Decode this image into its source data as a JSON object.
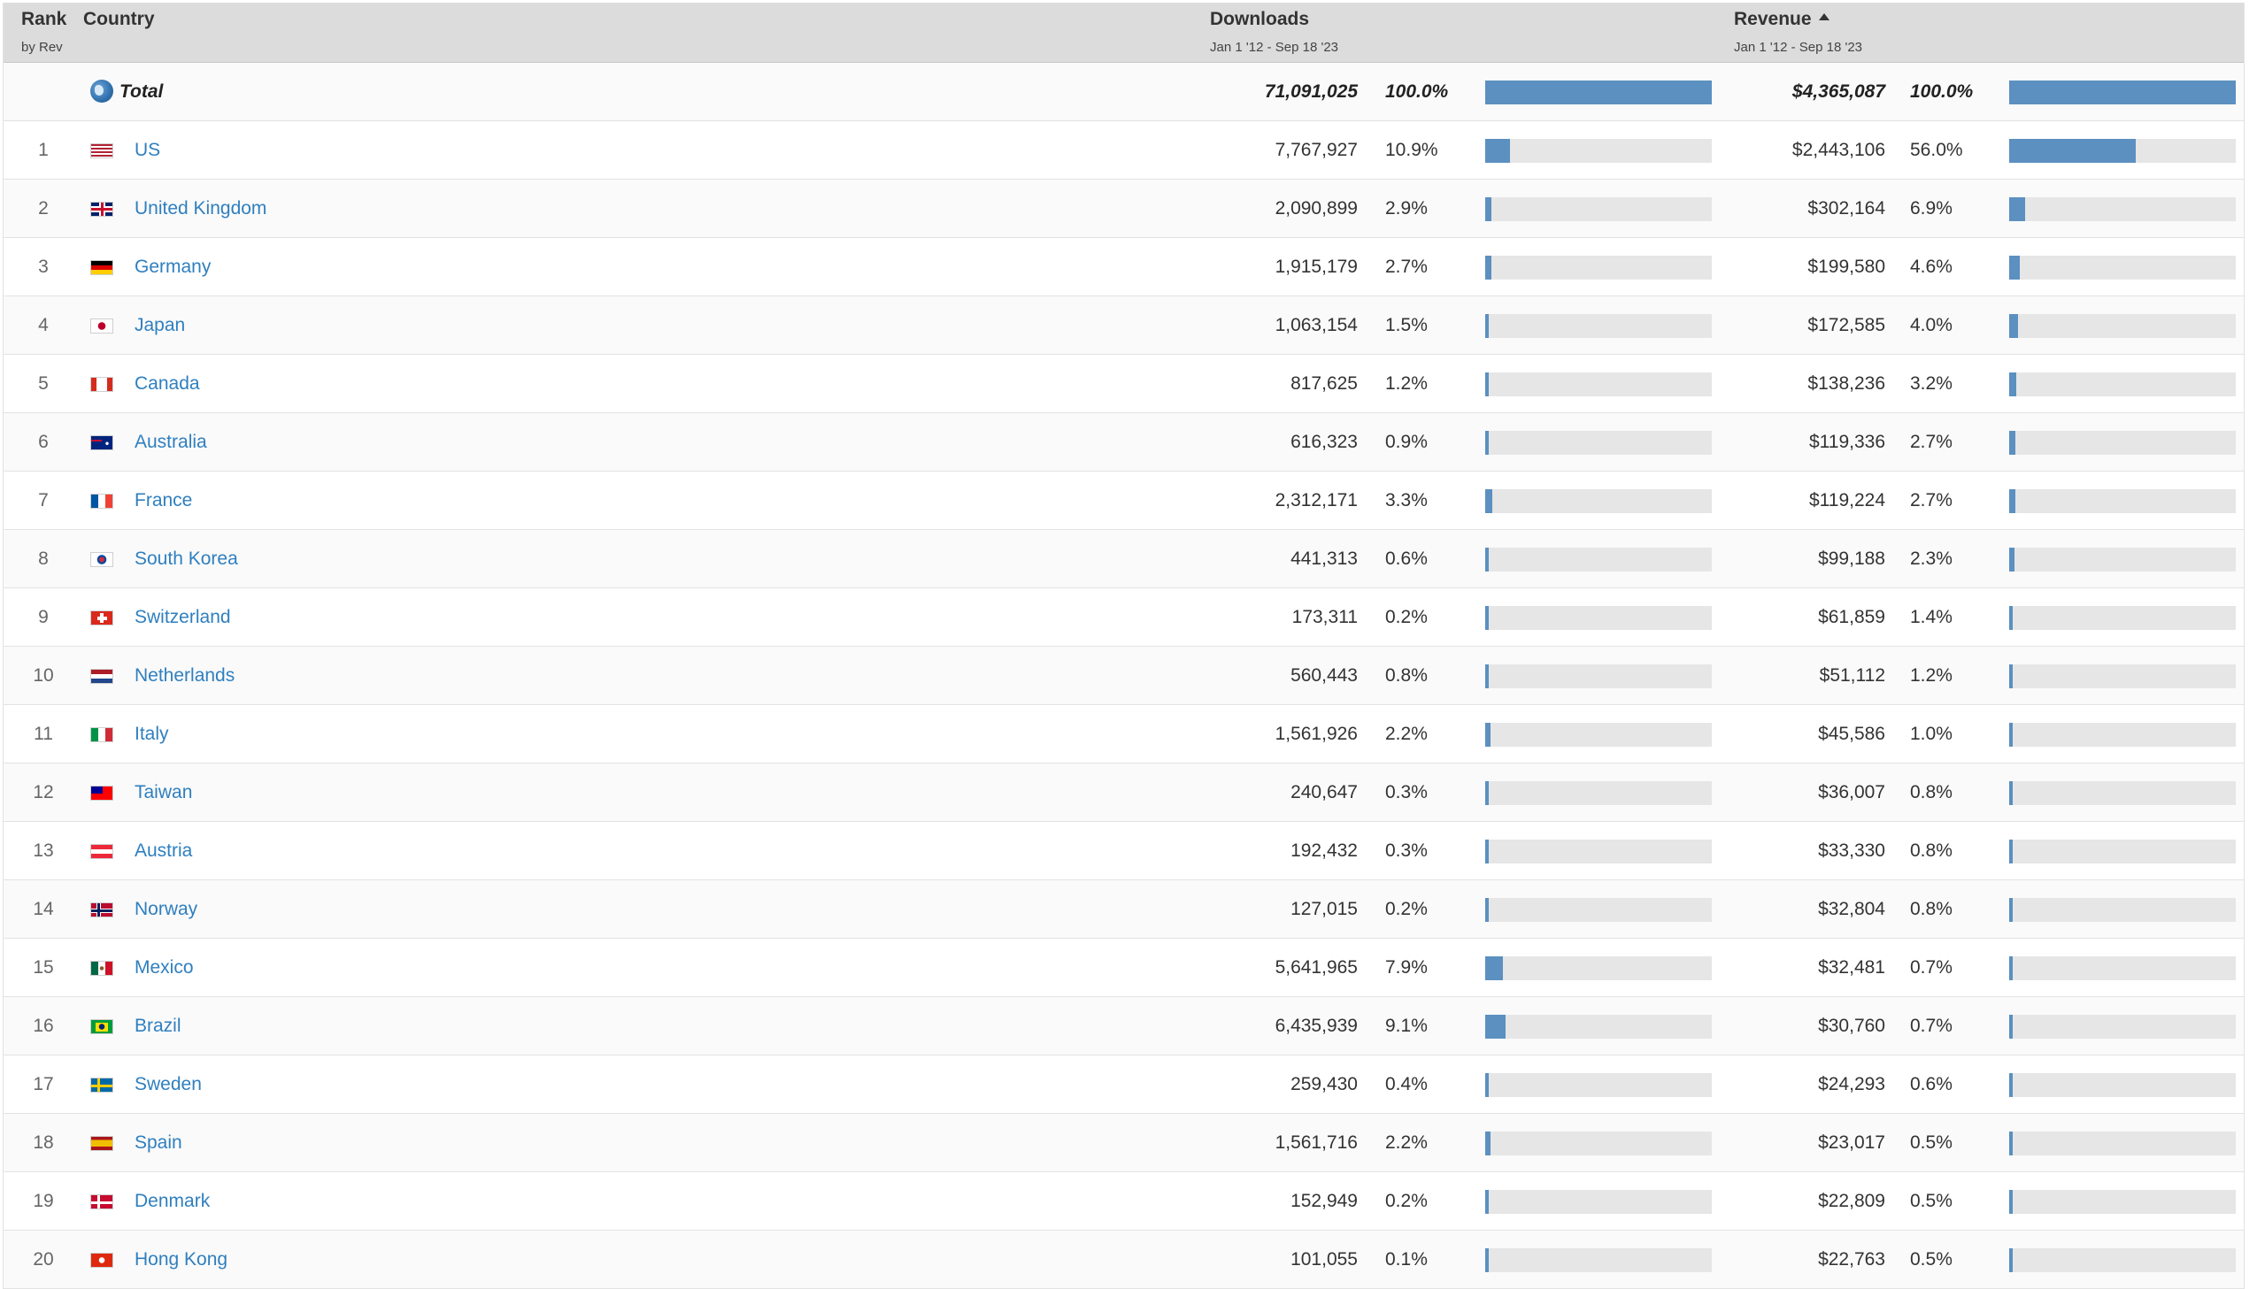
{
  "header": {
    "rank_label": "Rank",
    "rank_sub": "by Rev",
    "country_label": "Country",
    "downloads_label": "Downloads",
    "downloads_range": "Jan 1 '12 - Sep 18 '23",
    "revenue_label": "Revenue",
    "revenue_range": "Jan 1 '12 - Sep 18 '23"
  },
  "colors": {
    "bar": "#5b90c0",
    "track": "#e6e6e6",
    "link": "#2f7fbf"
  },
  "total": {
    "name": "Total",
    "downloads": "71,091,025",
    "downloads_pct": "100.0%",
    "downloads_share": 100.0,
    "revenue": "$4,365,087",
    "revenue_pct": "100.0%",
    "revenue_share": 100.0,
    "icon": "globe-icon"
  },
  "rows": [
    {
      "rank": "1",
      "name": "US",
      "flag": "us",
      "downloads": "7,767,927",
      "downloads_pct": "10.9%",
      "downloads_share": 10.9,
      "revenue": "$2,443,106",
      "revenue_pct": "56.0%",
      "revenue_share": 56.0
    },
    {
      "rank": "2",
      "name": "United Kingdom",
      "flag": "gb",
      "downloads": "2,090,899",
      "downloads_pct": "2.9%",
      "downloads_share": 2.9,
      "revenue": "$302,164",
      "revenue_pct": "6.9%",
      "revenue_share": 6.9
    },
    {
      "rank": "3",
      "name": "Germany",
      "flag": "de",
      "downloads": "1,915,179",
      "downloads_pct": "2.7%",
      "downloads_share": 2.7,
      "revenue": "$199,580",
      "revenue_pct": "4.6%",
      "revenue_share": 4.6
    },
    {
      "rank": "4",
      "name": "Japan",
      "flag": "jp",
      "downloads": "1,063,154",
      "downloads_pct": "1.5%",
      "downloads_share": 1.5,
      "revenue": "$172,585",
      "revenue_pct": "4.0%",
      "revenue_share": 4.0
    },
    {
      "rank": "5",
      "name": "Canada",
      "flag": "ca",
      "downloads": "817,625",
      "downloads_pct": "1.2%",
      "downloads_share": 1.2,
      "revenue": "$138,236",
      "revenue_pct": "3.2%",
      "revenue_share": 3.2
    },
    {
      "rank": "6",
      "name": "Australia",
      "flag": "au",
      "downloads": "616,323",
      "downloads_pct": "0.9%",
      "downloads_share": 0.9,
      "revenue": "$119,336",
      "revenue_pct": "2.7%",
      "revenue_share": 2.7
    },
    {
      "rank": "7",
      "name": "France",
      "flag": "fr",
      "downloads": "2,312,171",
      "downloads_pct": "3.3%",
      "downloads_share": 3.3,
      "revenue": "$119,224",
      "revenue_pct": "2.7%",
      "revenue_share": 2.7
    },
    {
      "rank": "8",
      "name": "South Korea",
      "flag": "kr",
      "downloads": "441,313",
      "downloads_pct": "0.6%",
      "downloads_share": 0.6,
      "revenue": "$99,188",
      "revenue_pct": "2.3%",
      "revenue_share": 2.3
    },
    {
      "rank": "9",
      "name": "Switzerland",
      "flag": "ch",
      "downloads": "173,311",
      "downloads_pct": "0.2%",
      "downloads_share": 0.2,
      "revenue": "$61,859",
      "revenue_pct": "1.4%",
      "revenue_share": 1.4
    },
    {
      "rank": "10",
      "name": "Netherlands",
      "flag": "nl",
      "downloads": "560,443",
      "downloads_pct": "0.8%",
      "downloads_share": 0.8,
      "revenue": "$51,112",
      "revenue_pct": "1.2%",
      "revenue_share": 1.2
    },
    {
      "rank": "11",
      "name": "Italy",
      "flag": "it",
      "downloads": "1,561,926",
      "downloads_pct": "2.2%",
      "downloads_share": 2.2,
      "revenue": "$45,586",
      "revenue_pct": "1.0%",
      "revenue_share": 1.0
    },
    {
      "rank": "12",
      "name": "Taiwan",
      "flag": "tw",
      "downloads": "240,647",
      "downloads_pct": "0.3%",
      "downloads_share": 0.3,
      "revenue": "$36,007",
      "revenue_pct": "0.8%",
      "revenue_share": 0.8
    },
    {
      "rank": "13",
      "name": "Austria",
      "flag": "at",
      "downloads": "192,432",
      "downloads_pct": "0.3%",
      "downloads_share": 0.3,
      "revenue": "$33,330",
      "revenue_pct": "0.8%",
      "revenue_share": 0.8
    },
    {
      "rank": "14",
      "name": "Norway",
      "flag": "no",
      "downloads": "127,015",
      "downloads_pct": "0.2%",
      "downloads_share": 0.2,
      "revenue": "$32,804",
      "revenue_pct": "0.8%",
      "revenue_share": 0.8
    },
    {
      "rank": "15",
      "name": "Mexico",
      "flag": "mx",
      "downloads": "5,641,965",
      "downloads_pct": "7.9%",
      "downloads_share": 7.9,
      "revenue": "$32,481",
      "revenue_pct": "0.7%",
      "revenue_share": 0.7
    },
    {
      "rank": "16",
      "name": "Brazil",
      "flag": "br",
      "downloads": "6,435,939",
      "downloads_pct": "9.1%",
      "downloads_share": 9.1,
      "revenue": "$30,760",
      "revenue_pct": "0.7%",
      "revenue_share": 0.7
    },
    {
      "rank": "17",
      "name": "Sweden",
      "flag": "se",
      "downloads": "259,430",
      "downloads_pct": "0.4%",
      "downloads_share": 0.4,
      "revenue": "$24,293",
      "revenue_pct": "0.6%",
      "revenue_share": 0.6
    },
    {
      "rank": "18",
      "name": "Spain",
      "flag": "es",
      "downloads": "1,561,716",
      "downloads_pct": "2.2%",
      "downloads_share": 2.2,
      "revenue": "$23,017",
      "revenue_pct": "0.5%",
      "revenue_share": 0.5
    },
    {
      "rank": "19",
      "name": "Denmark",
      "flag": "dk",
      "downloads": "152,949",
      "downloads_pct": "0.2%",
      "downloads_share": 0.2,
      "revenue": "$22,809",
      "revenue_pct": "0.5%",
      "revenue_share": 0.5
    },
    {
      "rank": "20",
      "name": "Hong Kong",
      "flag": "hk",
      "downloads": "101,055",
      "downloads_pct": "0.1%",
      "downloads_share": 0.1,
      "revenue": "$22,763",
      "revenue_pct": "0.5%",
      "revenue_share": 0.5
    }
  ]
}
